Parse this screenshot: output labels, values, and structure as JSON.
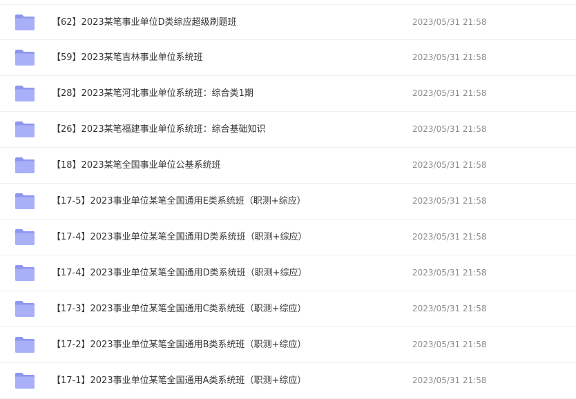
{
  "files": [
    {
      "name": "【62】2023某笔事业单位D类综应超级刷题班",
      "date": "2023/05/31 21:58",
      "icon": "folder-icon"
    },
    {
      "name": "【59】2023某笔吉林事业单位系统班",
      "date": "2023/05/31 21:58",
      "icon": "folder-icon"
    },
    {
      "name": "【28】2023某笔河北事业单位系统班：综合类1期",
      "date": "2023/05/31 21:58",
      "icon": "folder-icon"
    },
    {
      "name": "【26】2023某笔福建事业单位系统班：综合基础知识",
      "date": "2023/05/31 21:58",
      "icon": "folder-icon"
    },
    {
      "name": "【18】2023某笔全国事业单位公基系统班",
      "date": "2023/05/31 21:58",
      "icon": "folder-icon"
    },
    {
      "name": "【17-5】2023事业单位某笔全国通用E类系统班（职测+综应）",
      "date": "2023/05/31 21:58",
      "icon": "folder-icon"
    },
    {
      "name": "【17-4】2023事业单位某笔全国通用D类系统班（职测+综应）",
      "date": "2023/05/31 21:58",
      "icon": "folder-icon"
    },
    {
      "name": "【17-4】2023事业单位某笔全国通用D类系统班（职测+综应）",
      "date": "2023/05/31 21:58",
      "icon": "folder-icon"
    },
    {
      "name": "【17-3】2023事业单位某笔全国通用C类系统班（职测+综应）",
      "date": "2023/05/31 21:58",
      "icon": "folder-icon"
    },
    {
      "name": "【17-2】2023事业单位某笔全国通用B类系统班（职测+综应）",
      "date": "2023/05/31 21:58",
      "icon": "folder-icon"
    },
    {
      "name": "【17-1】2023事业单位某笔全国通用A类系统班（职测+综应）",
      "date": "2023/05/31 21:58",
      "icon": "folder-icon"
    }
  ],
  "colors": {
    "folder_back": "#8f96ef",
    "folder_front": "#a9b0f7",
    "name_text": "#333333",
    "date_text": "#8c8c8c"
  }
}
